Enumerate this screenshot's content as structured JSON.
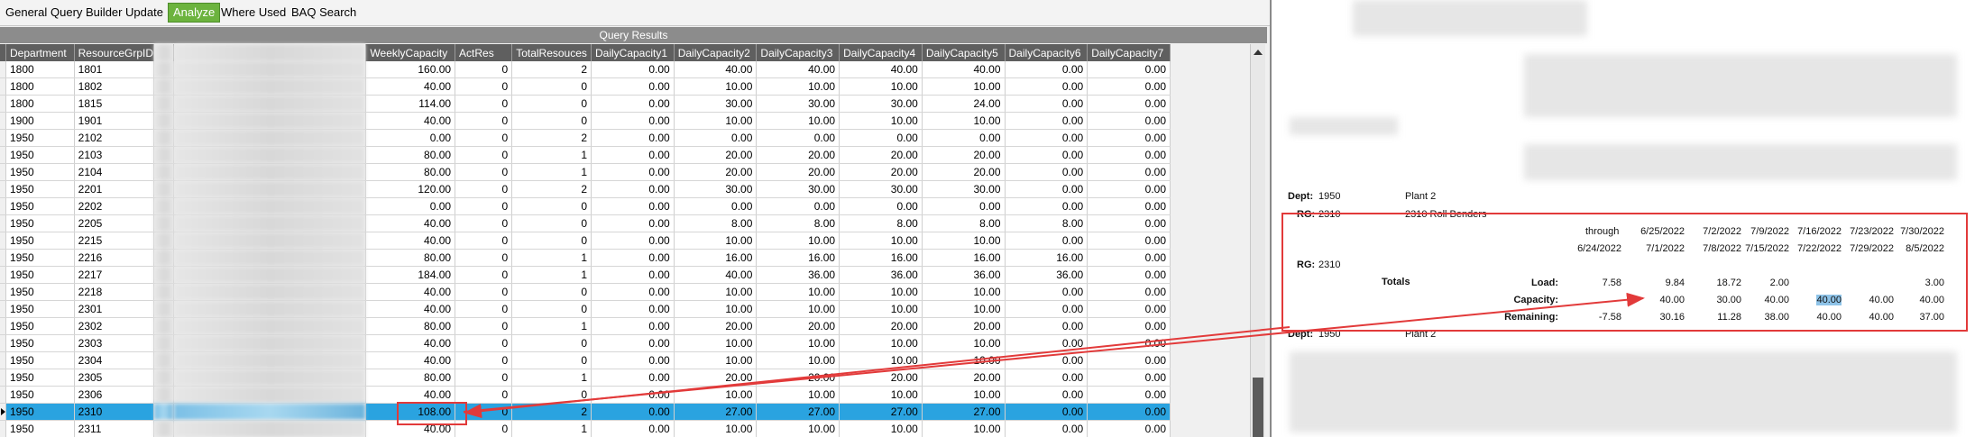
{
  "toolbar": {
    "tabs": [
      {
        "label": "General",
        "active": false
      },
      {
        "label": "Query Builder",
        "active": false
      },
      {
        "label": "Update",
        "active": false
      },
      {
        "label": "Analyze",
        "active": true
      },
      {
        "label": "Where Used",
        "active": false
      },
      {
        "label": "BAQ Search",
        "active": false
      }
    ]
  },
  "grid": {
    "title": "Query Results",
    "columns": [
      "Department",
      "ResourceGrpID",
      "",
      "",
      "WeeklyCapacity",
      "ActRes",
      "TotalResouces",
      "DailyCapacity1",
      "DailyCapacity2",
      "DailyCapacity3",
      "DailyCapacity4",
      "DailyCapacity5",
      "DailyCapacity6",
      "DailyCapacity7"
    ],
    "rows": [
      [
        "1800",
        "1801",
        "18",
        "",
        "160.00",
        "0",
        "2",
        "0.00",
        "40.00",
        "40.00",
        "40.00",
        "40.00",
        "0.00",
        "0.00"
      ],
      [
        "1800",
        "1802",
        "18",
        "",
        "40.00",
        "0",
        "0",
        "0.00",
        "10.00",
        "10.00",
        "10.00",
        "10.00",
        "0.00",
        "0.00"
      ],
      [
        "1800",
        "1815",
        "18",
        "",
        "114.00",
        "0",
        "0",
        "0.00",
        "30.00",
        "30.00",
        "30.00",
        "24.00",
        "0.00",
        "0.00"
      ],
      [
        "1900",
        "1901",
        "19",
        "",
        "40.00",
        "0",
        "0",
        "0.00",
        "10.00",
        "10.00",
        "10.00",
        "10.00",
        "0.00",
        "0.00"
      ],
      [
        "1950",
        "2102",
        "21",
        "",
        "0.00",
        "0",
        "2",
        "0.00",
        "0.00",
        "0.00",
        "0.00",
        "0.00",
        "0.00",
        "0.00"
      ],
      [
        "1950",
        "2103",
        "21",
        "",
        "80.00",
        "0",
        "1",
        "0.00",
        "20.00",
        "20.00",
        "20.00",
        "20.00",
        "0.00",
        "0.00"
      ],
      [
        "1950",
        "2104",
        "21",
        "",
        "80.00",
        "0",
        "1",
        "0.00",
        "20.00",
        "20.00",
        "20.00",
        "20.00",
        "0.00",
        "0.00"
      ],
      [
        "1950",
        "2201",
        "22",
        "",
        "120.00",
        "0",
        "2",
        "0.00",
        "30.00",
        "30.00",
        "30.00",
        "30.00",
        "0.00",
        "0.00"
      ],
      [
        "1950",
        "2202",
        "22",
        "",
        "0.00",
        "0",
        "0",
        "0.00",
        "0.00",
        "0.00",
        "0.00",
        "0.00",
        "0.00",
        "0.00"
      ],
      [
        "1950",
        "2205",
        "22",
        "",
        "40.00",
        "0",
        "0",
        "0.00",
        "8.00",
        "8.00",
        "8.00",
        "8.00",
        "8.00",
        "0.00"
      ],
      [
        "1950",
        "2215",
        "22",
        "",
        "40.00",
        "0",
        "0",
        "0.00",
        "10.00",
        "10.00",
        "10.00",
        "10.00",
        "0.00",
        "0.00"
      ],
      [
        "1950",
        "2216",
        "22",
        "",
        "80.00",
        "0",
        "1",
        "0.00",
        "16.00",
        "16.00",
        "16.00",
        "16.00",
        "16.00",
        "0.00"
      ],
      [
        "1950",
        "2217",
        "22",
        "",
        "184.00",
        "0",
        "1",
        "0.00",
        "40.00",
        "36.00",
        "36.00",
        "36.00",
        "36.00",
        "0.00"
      ],
      [
        "1950",
        "2218",
        "22",
        "",
        "40.00",
        "0",
        "0",
        "0.00",
        "10.00",
        "10.00",
        "10.00",
        "10.00",
        "0.00",
        "0.00"
      ],
      [
        "1950",
        "2301",
        "23",
        "",
        "40.00",
        "0",
        "0",
        "0.00",
        "10.00",
        "10.00",
        "10.00",
        "10.00",
        "0.00",
        "0.00"
      ],
      [
        "1950",
        "2302",
        "23",
        "",
        "80.00",
        "0",
        "1",
        "0.00",
        "20.00",
        "20.00",
        "20.00",
        "20.00",
        "0.00",
        "0.00"
      ],
      [
        "1950",
        "2303",
        "23",
        "",
        "40.00",
        "0",
        "0",
        "0.00",
        "10.00",
        "10.00",
        "10.00",
        "10.00",
        "0.00",
        "0.00"
      ],
      [
        "1950",
        "2304",
        "23",
        "",
        "40.00",
        "0",
        "0",
        "0.00",
        "10.00",
        "10.00",
        "10.00",
        "10.00",
        "0.00",
        "0.00"
      ],
      [
        "1950",
        "2305",
        "23",
        "",
        "80.00",
        "0",
        "1",
        "0.00",
        "20.00",
        "20.00",
        "20.00",
        "20.00",
        "0.00",
        "0.00"
      ],
      [
        "1950",
        "2306",
        "23",
        "",
        "40.00",
        "0",
        "0",
        "0.00",
        "10.00",
        "10.00",
        "10.00",
        "10.00",
        "0.00",
        "0.00"
      ],
      [
        "1950",
        "2310",
        "23",
        "",
        "108.00",
        "0",
        "2",
        "0.00",
        "27.00",
        "27.00",
        "27.00",
        "27.00",
        "0.00",
        "0.00"
      ],
      [
        "1950",
        "2311",
        "23",
        "",
        "40.00",
        "0",
        "1",
        "0.00",
        "10.00",
        "10.00",
        "10.00",
        "10.00",
        "0.00",
        "0.00"
      ]
    ],
    "selected_row": 20,
    "highlight_cell": {
      "row": 20,
      "col": 4
    }
  },
  "report": {
    "dept_label": "Dept:",
    "dept_value": "1950",
    "plant": "Plant 2",
    "rg_label": "RG:",
    "rg_value": "2310",
    "rg_name": "2310 Roll Benders",
    "through": "through",
    "date_from": [
      "6/25/2022",
      "7/2/2022",
      "7/9/2022",
      "7/16/2022",
      "7/23/2022",
      "7/30/2022"
    ],
    "date_to": [
      "6/24/2022",
      "7/1/2022",
      "7/8/2022",
      "7/15/2022",
      "7/22/2022",
      "7/29/2022",
      "8/5/2022"
    ],
    "rg2_label": "RG:",
    "rg2_value": "2310",
    "totals": "Totals",
    "load_label": "Load:",
    "load": [
      "7.58",
      "9.84",
      "18.72",
      "2.00",
      "",
      "",
      "3.00"
    ],
    "capacity_label": "Capacity:",
    "capacity": [
      "",
      "40.00",
      "30.00",
      "40.00",
      "40.00",
      "40.00",
      "40.00"
    ],
    "remaining_label": "Remaining:",
    "remaining": [
      "-7.58",
      "30.16",
      "11.28",
      "38.00",
      "40.00",
      "40.00",
      "37.00"
    ],
    "dept2_label": "Dept:",
    "dept2_value": "1950",
    "plant2": "Plant 2",
    "highlight_capacity_index": 4
  },
  "colors": {
    "selected_row": "#2aa3e0",
    "annotation": "#e23a3a",
    "active_tab": "#6cb33e"
  }
}
